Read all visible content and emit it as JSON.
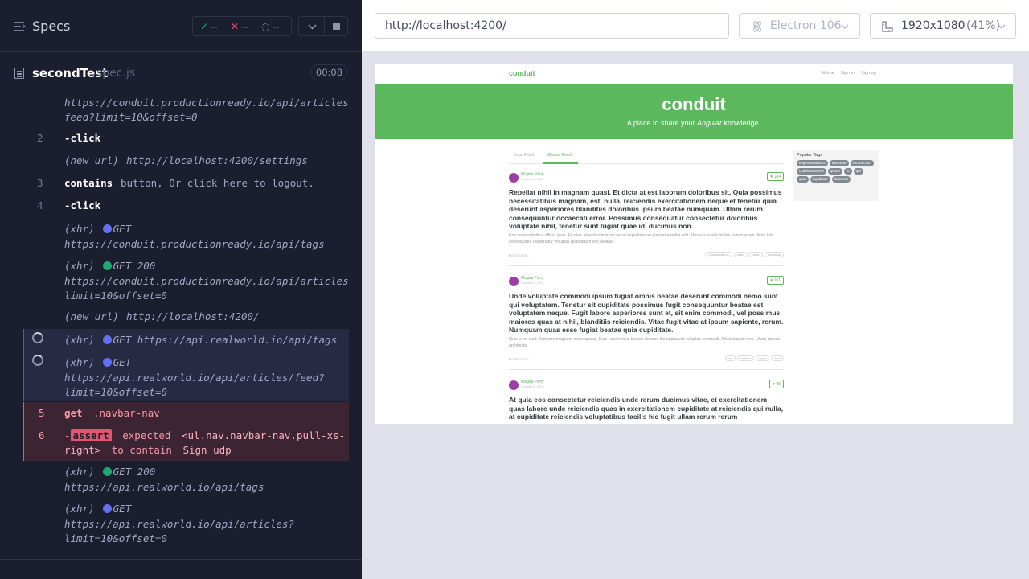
{
  "specs": {
    "title": "Specs",
    "stats": {
      "passed": "--",
      "failed": "--",
      "pending": "--"
    }
  },
  "file": {
    "name": "secondTest",
    "ext": "spec.js",
    "duration": "00:08"
  },
  "log": {
    "row0_url_line1": "https://conduit.productionready.io/api/articles/",
    "row0_url_line2": "feed?limit=10&offset=0",
    "row1_num": "2",
    "row1_cmd": "-click",
    "row2_label": "(new url)",
    "row2_url": "http://localhost:4200/settings",
    "row3_num": "3",
    "row3_cmd": "contains",
    "row3_arg": "button, Or click here to logout.",
    "row4_num": "4",
    "row4_cmd": "-click",
    "row5_label": "(xhr)",
    "row5_method": "GET",
    "row5_url": "https://conduit.productionready.io/api/tags",
    "row6_label": "(xhr)",
    "row6_method": "GET 200",
    "row6_url_line1": "https://conduit.productionready.io/api/articles?",
    "row6_url_line2": "limit=10&offset=0",
    "row7_label": "(new url)",
    "row7_url": "http://localhost:4200/",
    "row8_label": "(xhr)",
    "row8_method": "GET",
    "row8_url": "https://api.realworld.io/api/tags",
    "row9_label": "(xhr)",
    "row9_method": "GET",
    "row9_url_line1": "https://api.realworld.io/api/articles/feed?",
    "row9_url_line2": "limit=10&offset=0",
    "row10_num": "5",
    "row10_cmd": "get",
    "row10_arg": ".navbar-nav",
    "row11_num": "6",
    "row11_badge": "assert",
    "row11_expected": "expected",
    "row11_target_line1": "<ul.nav.navbar-nav.pull-xs-",
    "row11_target_line2": "right>",
    "row11_to_contain": "to contain",
    "row11_value": "Sign udp",
    "row12_label": "(xhr)",
    "row12_method": "GET 200",
    "row12_url": "https://api.realworld.io/api/tags",
    "row13_label": "(xhr)",
    "row13_method": "GET",
    "row13_url_line1": "https://api.realworld.io/api/articles?",
    "row13_url_line2": "limit=10&offset=0"
  },
  "toolbar": {
    "url": "http://localhost:4200/",
    "browser": "Electron 106",
    "viewport": "1920x1080",
    "scale": "(41%)"
  },
  "app": {
    "brand": "conduit",
    "nav": {
      "home": "Home",
      "sign_in": "Sign in",
      "sign_up": "Sign up"
    },
    "banner_title": "conduit",
    "banner_sub_prefix": "A place to share your ",
    "banner_sub_em": "Angular",
    "banner_sub_suffix": " knowledge.",
    "tabs": {
      "your_feed": "Your Feed",
      "global_feed": "Global Feed"
    },
    "popular_tags_title": "Popular Tags",
    "tags": [
      "implementations",
      "welcome",
      "introduction",
      "codebaseShow",
      "ipsum",
      "et",
      "qui",
      "quia",
      "cupiditate",
      "deserunt"
    ],
    "articles": [
      {
        "author": "Magda Parry",
        "date": "October 6, 2022",
        "likes": "184",
        "title": "Repellat nihil in magnam quasi. Et dicta at est laborum doloribus sit. Quia possimus necessitatibus magnam, est, nulla, reiciendis exercitationem neque et tenetur quia deserunt asperiores blanditiis doloribus ipsum beatae numquam. Ullam rerum consequuntur occaecati error. Possimus consequatur consectetur doloribus voluptate nihil, tenetur sunt fugiat quae id, ducimus non.",
        "desc": "Eos necessitatibus officia quos. Et vitae aliquid autem occaecati repudiandae placeat repellat odit. Minus iure voluptates autem quam dicta. Iste consequatur aspernatur voluptas quibusdam sint beatae.",
        "read_more": "Read more...",
        "tags": [
          "necessitatibus",
          "sequi",
          "vitae",
          "doloribus"
        ]
      },
      {
        "author": "Magda Parry",
        "date": "October 6, 2022",
        "likes": "101",
        "title": "Unde voluptate commodi ipsum fugiat omnis beatae deserunt commodi nemo sunt qui voluptatem. Tenetur sit cupiditate possimus fugit consequuntur beatae est voluptatem neque. Fugit labore asperiores sunt et, sit enim commodi, vel possimus maiores quas at nihil, blanditiis reiciendis. Vitae fugit vitae at ipsum sapiente, rerum. Numquam quas esse fugiat beatae quia cupiditate.",
        "desc": "Quis error sunt. Tempora magnam consequatur. Eum repellendus beatae dolores hic ut placeat voluptas commodi. Amet aliquid vero. Ullam ratione architecto.",
        "read_more": "Read more...",
        "tags": [
          "est",
          "beatae",
          "fugiat",
          "sunt"
        ]
      },
      {
        "author": "Magda Parry",
        "date": "October 6, 2022",
        "likes": "95",
        "title": "At quia eos consectetur reiciendis unde rerum ducimus vitae, et exercitationem quas labore unde reiciendis quas in exercitationem cupiditate at reiciendis qui nulla, at cupiditate reiciendis voluptatibus facilis hic fugit ullam rerum rerum"
      }
    ]
  },
  "colors": {
    "pass": "#1fa971",
    "fail": "#e45770",
    "pending": "#6470f3",
    "brand": "#5cb85c"
  }
}
